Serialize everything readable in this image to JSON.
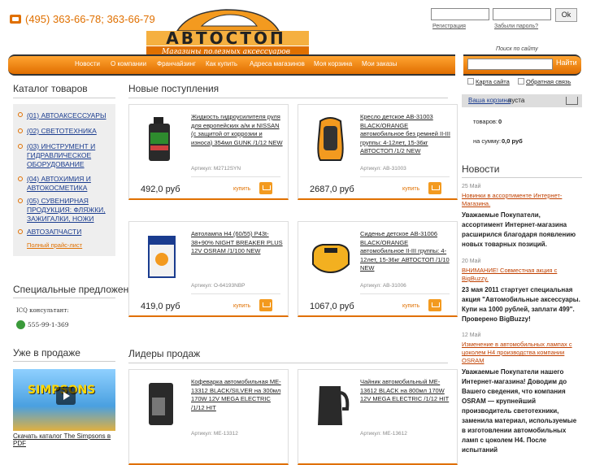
{
  "header": {
    "phone": "(495) 363-66-78; 363-66-79",
    "logo_text": "АВТОСТОП",
    "logo_sub": "Магазины полезных аксессуаров",
    "login_ok": "Ok",
    "register": "Регистрация",
    "forgot": "Забыли пароль?",
    "search_hint": "Поиск по сайту",
    "search_btn": "Найти"
  },
  "nav": [
    "Новости",
    "О компании",
    "Франчайзинг",
    "Как купить",
    "Адреса магазинов",
    "Моя корзина",
    "Мои заказы"
  ],
  "left": {
    "catalog_title": "Каталог товаров",
    "categories": [
      "(01) АВТОАКСЕССУАРЫ",
      "(02) СВЕТОТЕХНИКА",
      "(03) ИНСТРУМЕНТ И ГИДРАВЛИЧЕСКОЕ ОБОРУДОВАНИЕ",
      "(04) АВТОХИМИЯ И АВТОКОСМЕТИКА",
      "(05) СУВЕНИРНАЯ ПРОДУКЦИЯ: ФЛЯЖКИ, ЗАЖИГАЛКИ, НОЖИ",
      "АВТОЗАПЧАСТИ"
    ],
    "price_list": "Полный прайс-лист",
    "specials_title": "Специальные предложения",
    "icq_label": "ICQ консультант:",
    "icq_number": "555-99-1-369",
    "on_sale_title": "Уже в продаже",
    "catalog_link": "Скачать каталог The Simpsons в PDF"
  },
  "main": {
    "new_title": "Новые поступления",
    "leaders_title": "Лидеры продаж",
    "buy_label": "купить",
    "products": [
      {
        "name": "Жидкость гидроусилителя руля для европейских а/м и NISSAN (с защитой от коррозии и износа) 354мл GUNK /1/12 NEW",
        "article": "Артикул: M2712SYN",
        "price": "492,0 руб"
      },
      {
        "name": "Кресло детское AB-31003 BLACK/ORANGE автомобильное без ремней II-III группы: 4-12лет, 15-36кг АВТОСТОП /1/2 NEW",
        "article": "Артикул: AB-31003",
        "price": "2687,0 руб"
      },
      {
        "name": "Автолампа H4 (60/55) P43t-38+90% NIGHT BREAKER PLUS 12V OSRAM /1/100 NEW",
        "article": "Артикул: O-64193NBP",
        "price": "419,0 руб"
      },
      {
        "name": "Сиденье детское AB-31006 BLACK/ORANGE автомобильное II-III группы: 4-12лет, 15-36кг АВТОСТОП /1/10 NEW",
        "article": "Артикул: AB-31006",
        "price": "1067,0 руб"
      },
      {
        "name": "Кофеварка автомобильная ME-13312 BLACK/SILVER на 300мл 170W 12V MEGA ELECTRIC /1/12 HIT",
        "article": "Артикул: ME-13312",
        "price": ""
      },
      {
        "name": "Чайник автомобильный ME-13612 BLACK на 800мл 170W 12V MEGA ELECTRIC /1/12 HIT",
        "article": "Артикул: ME-13612",
        "price": ""
      }
    ]
  },
  "right": {
    "sitemap": "Карта сайта",
    "feedback": "Обратная связь",
    "basket_link": "Ваша корзина",
    "basket_status": "пуста",
    "items_label": "товаров:",
    "items_value": "0",
    "sum_label": "на сумму:",
    "sum_value": "0,0 руб",
    "news_title": "Новости",
    "news": [
      {
        "date": "25 Май",
        "link": "Новинки в ассортименте Интернет-Магазина.",
        "text": "Уважаемые Покупатели, ассортимент Интернет-магазина расширился благодаря появлению новых товарных позиций."
      },
      {
        "date": "20 Май",
        "link": "ВНИМАНИЕ! Совместная акция с BigBuzzy.",
        "text": "23 мая 2011 стартует специальная акция \"Автомобильные аксессуары. Купи на 1000 рублей, заплати 499\". Проверено BigBuzzy!"
      },
      {
        "date": "12 Май",
        "link": "Изменение в автомобильных лампах с цоколем H4 производства компании OSRAM",
        "text": "Уважаемые Покупатели нашего Интернет-магазина! Доводим до Вашего сведения, что компания OSRAM — крупнейший производитель светотехники, заменила материал, используемые в изготовлении автомобильных ламп с цоколем H4. После испытаний"
      }
    ]
  },
  "colors": {
    "accent": "#e07000",
    "link": "#1a3c8f"
  }
}
